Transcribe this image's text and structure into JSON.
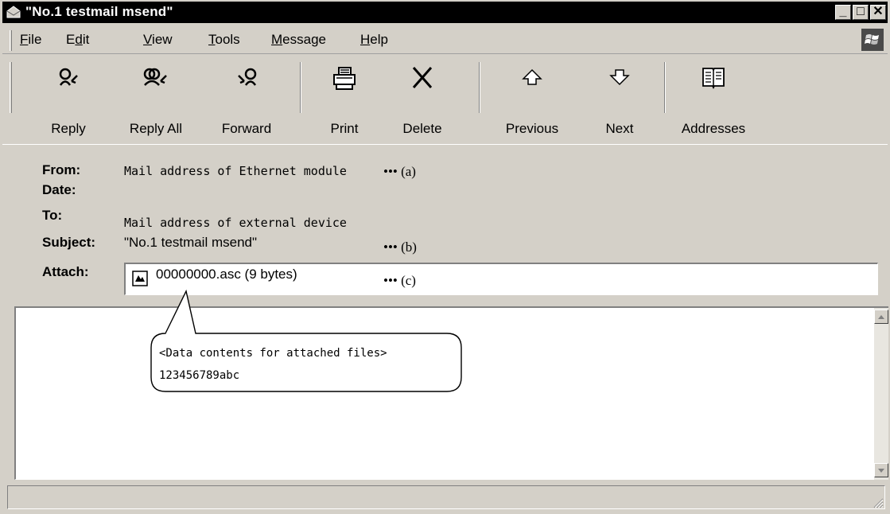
{
  "window": {
    "title": "\"No.1 testmail msend\"",
    "minimize_glyph": "_",
    "maximize_glyph": "□",
    "close_glyph": "✕",
    "accent": "#000000"
  },
  "menu": [
    {
      "id": "file",
      "label_u": "F",
      "label_rest": "ile"
    },
    {
      "id": "edit",
      "label_pre": "E",
      "label_u": "d",
      "label_rest": "it"
    },
    {
      "id": "view",
      "label_u": "V",
      "label_rest": "iew"
    },
    {
      "id": "tools",
      "label_u": "T",
      "label_rest": "ools"
    },
    {
      "id": "message",
      "label_u": "M",
      "label_rest": "essage"
    },
    {
      "id": "help",
      "label_u": "H",
      "label_rest": "elp"
    }
  ],
  "toolbar": {
    "reply": "Reply",
    "reply_all": "Reply All",
    "forward": "Forward",
    "print": "Print",
    "delete": "Delete",
    "previous": "Previous",
    "next": "Next",
    "addresses": "Addresses"
  },
  "header": {
    "from_label": "From:",
    "date_label": "Date:",
    "to_label": "To:",
    "subject_label": "Subject:",
    "attach_label": "Attach:",
    "from_value": "Mail address of Ethernet module",
    "to_value": "Mail address of external device",
    "subject_value": "\"No.1 testmail msend\"",
    "attach_value": "00000000.asc (9 bytes)",
    "note_a": "••• (a)",
    "note_b": "••• (b)",
    "note_c": "••• (c)"
  },
  "callout": {
    "title": "<Data contents for attached files>",
    "content": "123456789abc"
  },
  "icons": {
    "app": "envelope-icon",
    "attach": "attachment-icon",
    "logo": "windows-logo-icon"
  }
}
